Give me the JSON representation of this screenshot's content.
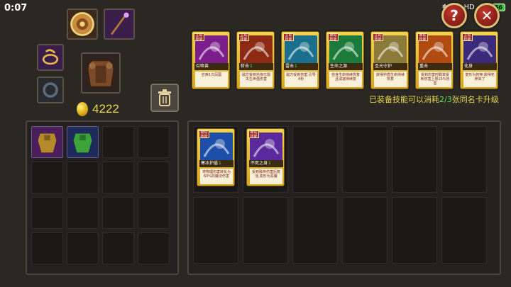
{
  "status": {
    "time": "0:07",
    "bluetooth_icon": "bluetooth-icon",
    "alarm_icon": "alarm-icon",
    "hd": "HD",
    "network": "4G",
    "battery": "66"
  },
  "top_buttons": {
    "help": "?",
    "close": "✕"
  },
  "gold": {
    "amount": "4222"
  },
  "equipped_skills": [
    {
      "tag": "主动技能",
      "name": "召唤兽",
      "level": "",
      "desc": "召唤1只凤凰",
      "color": "#7b1e8c"
    },
    {
      "tag": "主动技能",
      "name": "斩击",
      "level": "1",
      "desc": "敌方受到自身已损失生命值伤害",
      "color": "#8c2a14"
    },
    {
      "tag": "主动技能",
      "name": "雷击",
      "level": "1",
      "desc": "敌方受到伤害,引导4秒",
      "color": "#1a6f8c"
    },
    {
      "tag": "被动技能",
      "name": "生命之源",
      "level": "",
      "desc": "自身生命持续恢复且减速持续复",
      "color": "#1c7a3a"
    },
    {
      "tag": "主动技能",
      "name": "圣光守护",
      "level": "",
      "desc": "获得护盾生命持续恢复",
      "color": "#8c7a3a"
    },
    {
      "tag": "被动技能",
      "name": "重击",
      "level": "",
      "desc": "受到伤害时概率受到伤害上限15%伤害",
      "color": "#b04a10"
    },
    {
      "tag": "主动技能",
      "name": "化身",
      "level": "",
      "desc": "变形为死神,获得死神来了",
      "color": "#3a2a7c"
    }
  ],
  "info": {
    "prefix": "已装备技能可以消耗",
    "fraction": "2/3",
    "suffix": "张同名卡升级"
  },
  "owned_skills": [
    {
      "tag": "被动技能",
      "name": "寒冰护盾",
      "level": "1",
      "desc": "将物理伤害转化为60%的魔法伤害",
      "color": "#1e4fa8"
    },
    {
      "tag": "被动技能",
      "name": "不死之身",
      "level": "1",
      "desc": "受到致命伤害后复活,变形为恶魔",
      "color": "#5a2a9c"
    }
  ],
  "equipment_slots": [
    {
      "name": "shield",
      "icon": "shield-icon"
    },
    {
      "name": "staff",
      "icon": "staff-icon"
    },
    {
      "name": "ring",
      "icon": "ring-icon"
    },
    {
      "name": "armor",
      "icon": "armor-icon"
    },
    {
      "name": "amulet",
      "icon": "amulet-icon"
    }
  ],
  "inventory_items": [
    {
      "icon": "robe-icon",
      "color": "#b48a2a"
    },
    {
      "icon": "tunic-icon",
      "color": "#3ca33a"
    }
  ]
}
